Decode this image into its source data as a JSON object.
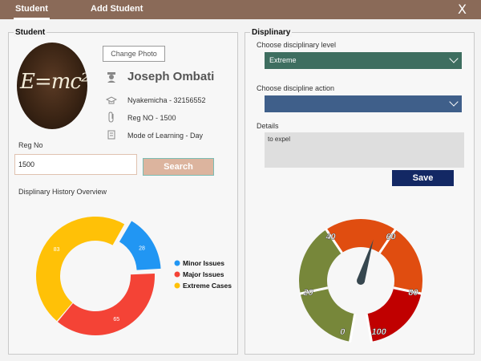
{
  "tabs": [
    {
      "label": "Student",
      "active": true
    },
    {
      "label": "Add Student",
      "active": false
    }
  ],
  "close_label": "X",
  "student_panel": {
    "title": "Student",
    "photo_text": "E=mc²",
    "change_photo_label": "Change Photo",
    "name": "Joseph Ombati",
    "location": "Nyakemicha - 32156552",
    "reg_no_text": "Reg NO - 1500",
    "mode_text": "Mode of Learning - Day",
    "reg_label": "Reg No",
    "reg_input_value": "1500",
    "search_label": "Search",
    "history_title": "Displinary History Overview"
  },
  "discipline_panel": {
    "title": "Displinary",
    "level_label": "Choose disciplinary level",
    "level_value": "Extreme",
    "level_color": "#3e6e60",
    "action_label": "Choose discipline action",
    "action_value": "",
    "action_color": "#3f5f8a",
    "details_label": "Details",
    "details_value": "to expel",
    "save_label": "Save"
  },
  "chart_data": [
    {
      "type": "pie",
      "variant": "donut",
      "title": "Displinary History Overview",
      "slices": [
        {
          "name": "Minor Issues",
          "value": 28,
          "color": "#2196f3"
        },
        {
          "name": "Major Issues",
          "value": 65,
          "color": "#f44336"
        },
        {
          "name": "Extreme Cases",
          "value": 83,
          "color": "#ffc107"
        }
      ],
      "legend": "right"
    },
    {
      "type": "gauge",
      "min": 0,
      "max": 100,
      "value": 55,
      "ticks": [
        0,
        20,
        40,
        60,
        80,
        100
      ],
      "bands": [
        {
          "from": 0,
          "to": 40,
          "color": "#77873a"
        },
        {
          "from": 40,
          "to": 80,
          "color": "#e04d10"
        },
        {
          "from": 80,
          "to": 100,
          "color": "#c00000"
        }
      ]
    }
  ]
}
